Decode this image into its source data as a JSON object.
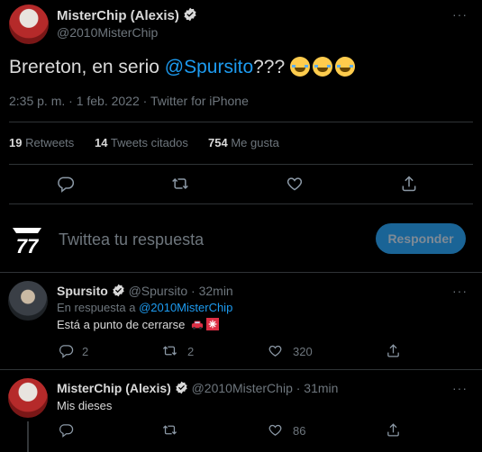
{
  "main_tweet": {
    "display_name": "MisterChip (Alexis)",
    "handle": "@2010MisterChip",
    "text_before": "Brereton, en serio ",
    "mention": "@Spursito",
    "text_after": "??? ",
    "emoji_name": "face-with-tears-of-joy",
    "timestamp": "2:35 p. m. · 1 feb. 2022 · Twitter for iPhone"
  },
  "stats": {
    "retweets_count": "19",
    "retweets_label": "Retweets",
    "quotes_count": "14",
    "quotes_label": "Tweets citados",
    "likes_count": "754",
    "likes_label": "Me gusta"
  },
  "compose": {
    "placeholder": "Twittea tu respuesta",
    "reply_button": "Responder"
  },
  "replies": [
    {
      "display_name": "Spursito",
      "handle": "@Spursito",
      "time": "· 32min",
      "reply_to_label": "En respuesta a ",
      "reply_to_handle": "@2010MisterChip",
      "text": "Está a punto de cerrarse",
      "reply_count": "2",
      "retweet_count": "2",
      "like_count": "320"
    },
    {
      "display_name": "MisterChip (Alexis)",
      "handle": "@2010MisterChip",
      "time": "· 31min",
      "text": "Mis dieses",
      "like_count": "86"
    }
  ],
  "colors": {
    "accent": "#1d9bf0",
    "background": "#000000",
    "muted": "#6e767d"
  }
}
